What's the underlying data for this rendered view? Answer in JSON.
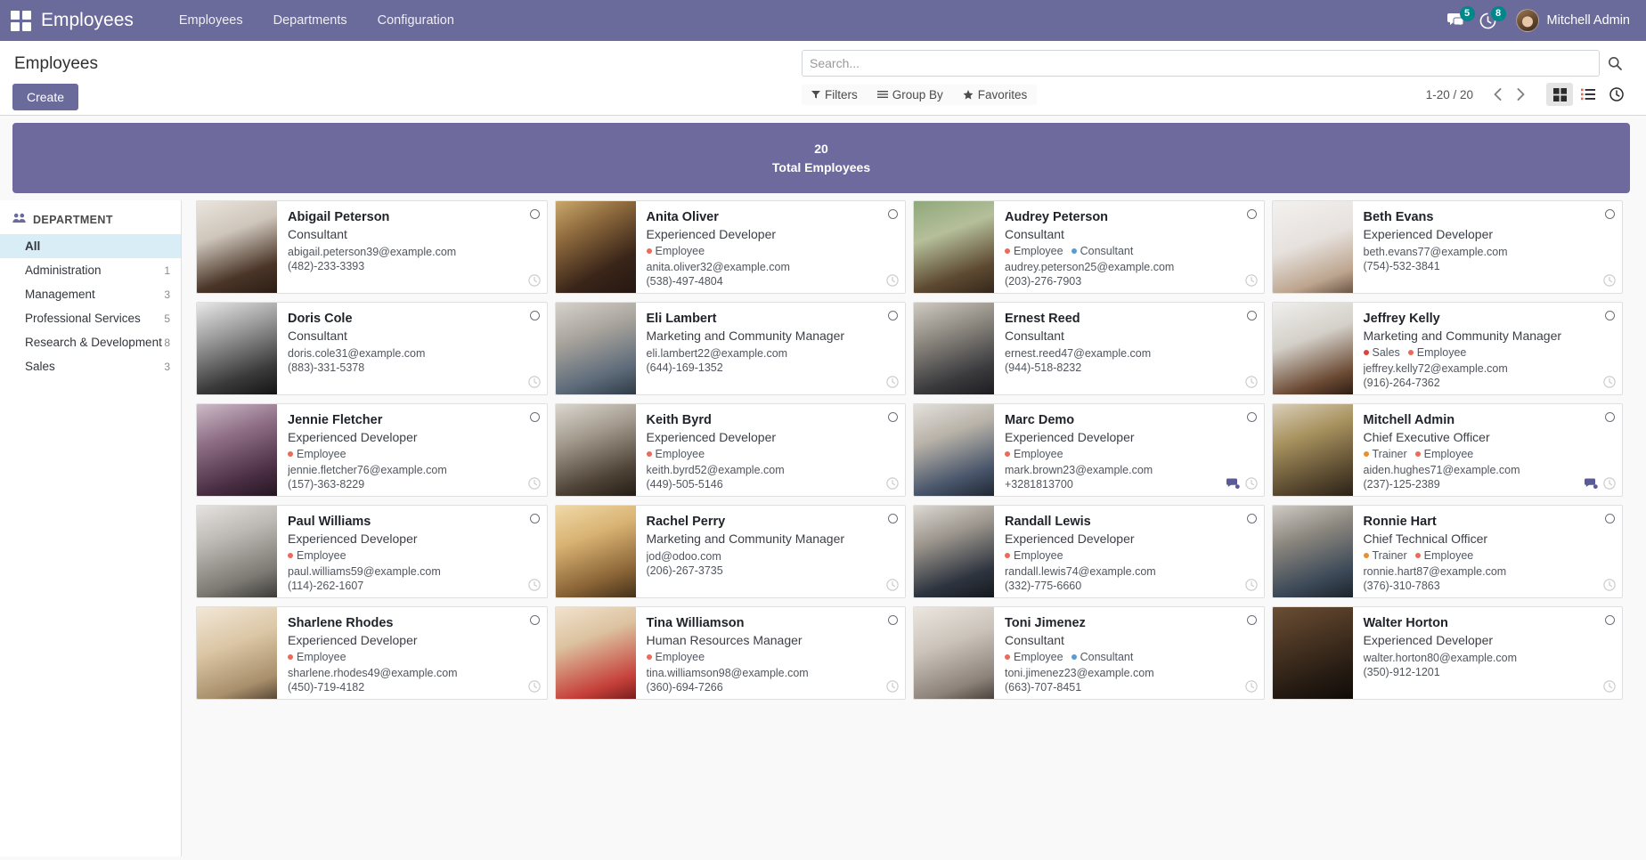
{
  "navbar": {
    "apps_icon": "apps-grid-icon",
    "brand": "Employees",
    "menu": [
      {
        "label": "Employees"
      },
      {
        "label": "Departments"
      },
      {
        "label": "Configuration"
      }
    ],
    "messages_icon": "chat-bubble-icon",
    "messages_count": "5",
    "activity_icon": "clock-icon",
    "activity_count": "8",
    "user_name": "Mitchell Admin",
    "accent": "#6a6a9b",
    "badge_color": "#00878a"
  },
  "control_panel": {
    "title": "Employees",
    "create_label": "Create",
    "search": {
      "placeholder": "Search...",
      "value": "",
      "icon": "search-icon"
    },
    "facets": [
      {
        "label": "Filters",
        "icon": "filter-icon"
      },
      {
        "label": "Group By",
        "icon": "list-lines-icon"
      },
      {
        "label": "Favorites",
        "icon": "star-icon"
      }
    ],
    "pager": {
      "value": "1-20 / 20",
      "prev_icon": "chevron-left-icon",
      "next_icon": "chevron-right-icon"
    },
    "views": [
      {
        "name": "kanban",
        "icon": "kanban-grid-icon",
        "active": true
      },
      {
        "name": "list",
        "icon": "list-icon",
        "active": false
      },
      {
        "name": "activity",
        "icon": "clock-icon",
        "active": false
      }
    ]
  },
  "banner": {
    "value": "20",
    "label": "Total Employees",
    "color": "#6e6a9e"
  },
  "sidebar": {
    "header": "DEPARTMENT",
    "header_icon": "people-icon",
    "items": [
      {
        "label": "All",
        "count": "",
        "active": true
      },
      {
        "label": "Administration",
        "count": "1",
        "active": false
      },
      {
        "label": "Management",
        "count": "3",
        "active": false
      },
      {
        "label": "Professional Services",
        "count": "5",
        "active": false
      },
      {
        "label": "Research & Development",
        "count": "8",
        "active": false
      },
      {
        "label": "Sales",
        "count": "3",
        "active": false
      }
    ]
  },
  "tag_colors": {
    "Employee": "#eb6a59",
    "Consultant": "#5b9bd5",
    "Sales": "#e0413a",
    "Trainer": "#e8902c"
  },
  "employees": [
    {
      "name": "Abigail Peterson",
      "job": "Consultant",
      "tags": [],
      "email": "abigail.peterson39@example.com",
      "phone": "(482)-233-3393",
      "has_chat": false,
      "photo": "woman-curly-dark-hair"
    },
    {
      "name": "Anita Oliver",
      "job": "Experienced Developer",
      "tags": [
        "Employee"
      ],
      "email": "anita.oliver32@example.com",
      "phone": "(538)-497-4804",
      "has_chat": false,
      "photo": "woman-long-dark-hair"
    },
    {
      "name": "Audrey Peterson",
      "job": "Consultant",
      "tags": [
        "Employee",
        "Consultant"
      ],
      "email": "audrey.peterson25@example.com",
      "phone": "(203)-276-7903",
      "has_chat": false,
      "photo": "woman-outdoor-green"
    },
    {
      "name": "Beth Evans",
      "job": "Experienced Developer",
      "tags": [],
      "email": "beth.evans77@example.com",
      "phone": "(754)-532-3841",
      "has_chat": false,
      "photo": "woman-short-hair-white-bg"
    },
    {
      "name": "Doris Cole",
      "job": "Consultant",
      "tags": [],
      "email": "doris.cole31@example.com",
      "phone": "(883)-331-5378",
      "has_chat": false,
      "photo": "woman-glasses-bw"
    },
    {
      "name": "Eli Lambert",
      "job": "Marketing and Community Manager",
      "tags": [],
      "email": "eli.lambert22@example.com",
      "phone": "(644)-169-1352",
      "has_chat": false,
      "photo": "man-beard-blue-shirt"
    },
    {
      "name": "Ernest Reed",
      "job": "Consultant",
      "tags": [],
      "email": "ernest.reed47@example.com",
      "phone": "(944)-518-8232",
      "has_chat": false,
      "photo": "man-dark-tshirt"
    },
    {
      "name": "Jeffrey Kelly",
      "job": "Marketing and Community Manager",
      "tags": [
        "Sales",
        "Employee"
      ],
      "email": "jeffrey.kelly72@example.com",
      "phone": "(916)-264-7362",
      "has_chat": false,
      "photo": "man-white-shirt"
    },
    {
      "name": "Jennie Fletcher",
      "job": "Experienced Developer",
      "tags": [
        "Employee"
      ],
      "email": "jennie.fletcher76@example.com",
      "phone": "(157)-363-8229",
      "has_chat": false,
      "photo": "woman-pink-hair"
    },
    {
      "name": "Keith Byrd",
      "job": "Experienced Developer",
      "tags": [
        "Employee"
      ],
      "email": "keith.byrd52@example.com",
      "phone": "(449)-505-5146",
      "has_chat": false,
      "photo": "man-smiling-dark"
    },
    {
      "name": "Marc Demo",
      "job": "Experienced Developer",
      "tags": [
        "Employee"
      ],
      "email": "mark.brown23@example.com",
      "phone": "+3281813700",
      "has_chat": true,
      "photo": "man-suit-blue-shirt"
    },
    {
      "name": "Mitchell Admin",
      "job": "Chief Executive Officer",
      "tags": [
        "Trainer",
        "Employee"
      ],
      "email": "aiden.hughes71@example.com",
      "phone": "(237)-125-2389",
      "has_chat": true,
      "photo": "man-glasses-smiling"
    },
    {
      "name": "Paul Williams",
      "job": "Experienced Developer",
      "tags": [
        "Employee"
      ],
      "email": "paul.williams59@example.com",
      "phone": "(114)-262-1607",
      "has_chat": false,
      "photo": "man-glasses-grey-jacket"
    },
    {
      "name": "Rachel Perry",
      "job": "Marketing and Community Manager",
      "tags": [],
      "email": "jod@odoo.com",
      "phone": "(206)-267-3735",
      "has_chat": false,
      "photo": "woman-blonde-warm"
    },
    {
      "name": "Randall Lewis",
      "job": "Experienced Developer",
      "tags": [
        "Employee"
      ],
      "email": "randall.lewis74@example.com",
      "phone": "(332)-775-6660",
      "has_chat": false,
      "photo": "man-suit-tie"
    },
    {
      "name": "Ronnie Hart",
      "job": "Chief Technical Officer",
      "tags": [
        "Trainer",
        "Employee"
      ],
      "email": "ronnie.hart87@example.com",
      "phone": "(376)-310-7863",
      "has_chat": false,
      "photo": "man-beard-crossed-arms"
    },
    {
      "name": "Sharlene Rhodes",
      "job": "Experienced Developer",
      "tags": [
        "Employee"
      ],
      "email": "sharlene.rhodes49@example.com",
      "phone": "(450)-719-4182",
      "has_chat": false,
      "photo": "woman-blonde-light"
    },
    {
      "name": "Tina Williamson",
      "job": "Human Resources Manager",
      "tags": [
        "Employee"
      ],
      "email": "tina.williamson98@example.com",
      "phone": "(360)-694-7266",
      "has_chat": false,
      "photo": "woman-red-top"
    },
    {
      "name": "Toni Jimenez",
      "job": "Consultant",
      "tags": [
        "Employee",
        "Consultant"
      ],
      "email": "toni.jimenez23@example.com",
      "phone": "(663)-707-8451",
      "has_chat": false,
      "photo": "woman-surprised"
    },
    {
      "name": "Walter Horton",
      "job": "Experienced Developer",
      "tags": [],
      "email": "walter.horton80@example.com",
      "phone": "(350)-912-1201",
      "has_chat": false,
      "photo": "man-dark-skin-dark-bg"
    }
  ]
}
